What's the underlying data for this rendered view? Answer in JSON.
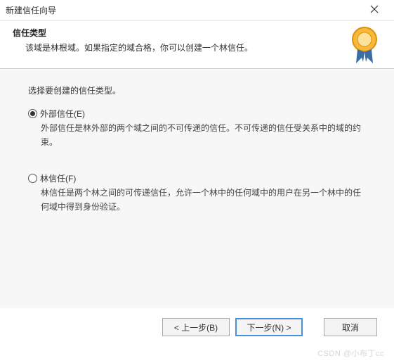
{
  "window": {
    "title": "新建信任向导"
  },
  "header": {
    "title": "信任类型",
    "description": "该域是林根域。如果指定的域合格，你可以创建一个林信任。"
  },
  "content": {
    "prompt": "选择要创建的信任类型。",
    "options": [
      {
        "id": "external",
        "label": "外部信任(E)",
        "description": "外部信任是林外部的两个域之间的不可传递的信任。不可传递的信任受关系中的域的约束。",
        "checked": true
      },
      {
        "id": "forest",
        "label": "林信任(F)",
        "description": "林信任是两个林之间的可传递信任，允许一个林中的任何域中的用户在另一个林中的任何域中得到身份验证。",
        "checked": false
      }
    ]
  },
  "buttons": {
    "back": "< 上一步(B)",
    "next": "下一步(N) >",
    "cancel": "取消"
  },
  "watermark": "CSDN @小布丁cc"
}
